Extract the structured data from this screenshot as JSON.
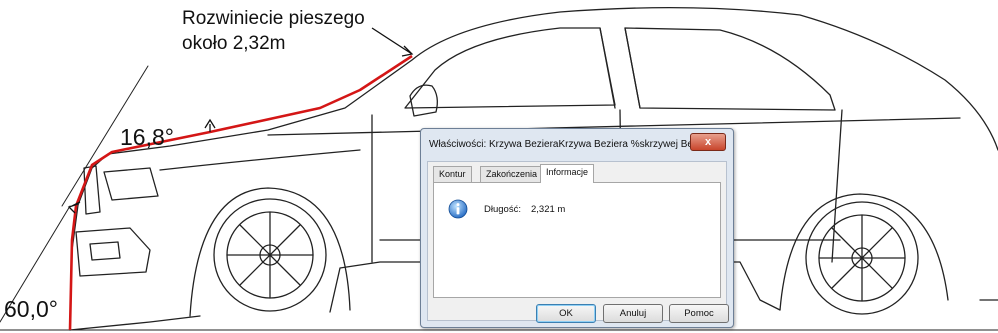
{
  "annotation": {
    "line1": "Rozwiniecie pieszego",
    "line2": "około 2,32m",
    "angle_upper": "16,8°",
    "angle_lower": "60,0°"
  },
  "dialog": {
    "title": "Właściwości: Krzywa BezieraKrzywa Beziera %skrzywej Bezi...",
    "close_label": "x",
    "tabs": [
      {
        "label": "Kontur"
      },
      {
        "label": "Zakończenia"
      },
      {
        "label": "Informacje"
      }
    ],
    "length_label": "Długość:",
    "length_value": "2,321 m",
    "buttons": {
      "ok": "OK",
      "cancel": "Anuluj",
      "help": "Pomoc"
    }
  },
  "colors": {
    "path": "#d41616",
    "lines": "#222222",
    "dialog_frame": "#dfe7f1"
  }
}
